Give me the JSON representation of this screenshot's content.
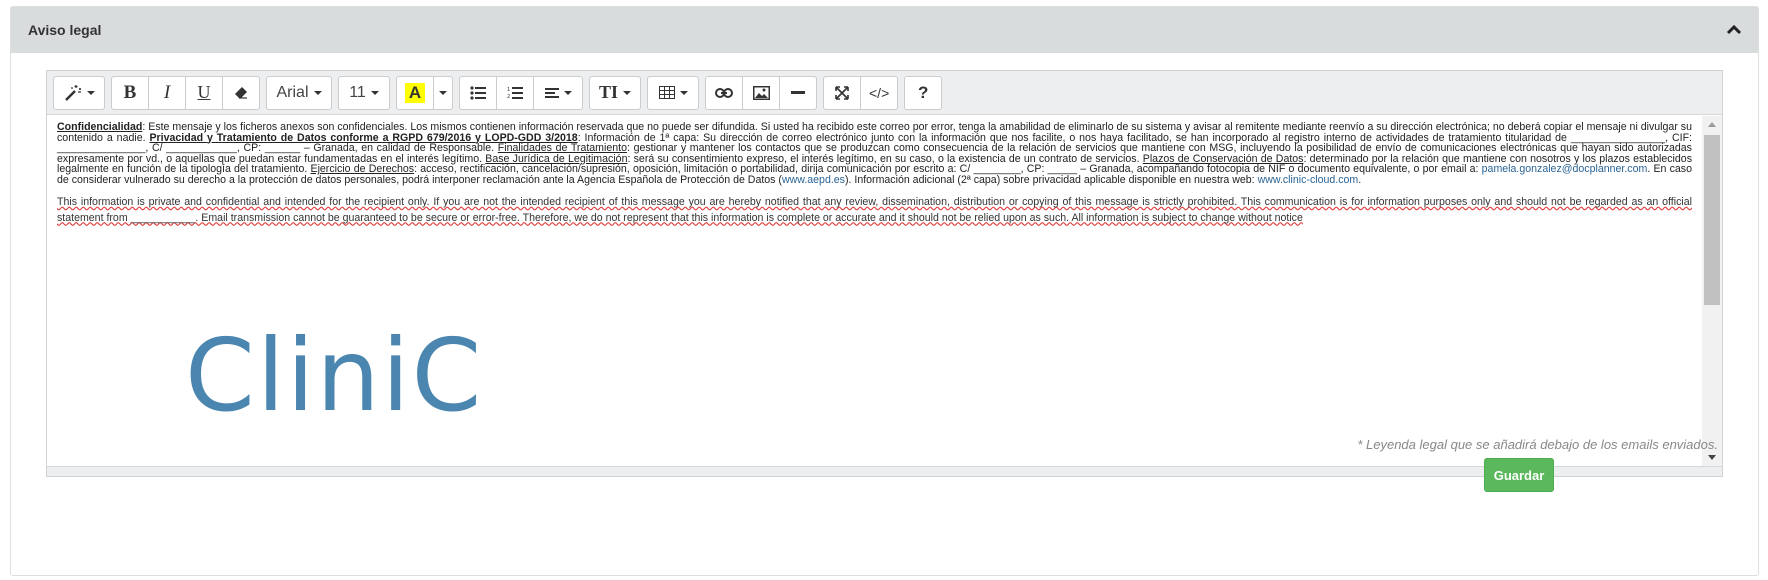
{
  "panel": {
    "title": "Aviso legal",
    "collapse_icon": "chevron-up-icon"
  },
  "toolbar": {
    "style_icon": "magic-wand-icon",
    "bold_label": "B",
    "italic_label": "I",
    "underline_label": "U",
    "eraser_icon": "eraser-icon",
    "font_name": "Arial",
    "font_size": "11",
    "color_label": "A",
    "color_highlight": "#ffff00",
    "ul_icon": "unordered-list-icon",
    "ol_icon": "ordered-list-icon",
    "align_icon": "align-left-icon",
    "line_height_label": "TI",
    "table_icon": "table-icon",
    "link_icon": "link-icon",
    "picture_icon": "picture-icon",
    "hr_icon": "horizontal-rule-icon",
    "fullscreen_icon": "fullscreen-icon",
    "code_label": "</>",
    "help_label": "?"
  },
  "content": {
    "conf_label": "Confidencialidad",
    "conf_text": ": Este mensaje y los ficheros anexos son confidenciales. Los mismos contienen información reservada que no puede ser difundida. Si usted ha recibido este correo por error, tenga la amabilidad de eliminarlo de su sistema y avisar al remitente mediante reenvío a su dirección electrónica; no deberá copiar el mensaje ni divulgar su contenido a nadie. ",
    "priv_label": "Privacidad y Tratamiento de Datos conforme a RGPD 679/2016 y LOPD-GDD 3/2018",
    "priv_text": ": Información de 1ª capa: Su dirección de correo electrónico junto con la información que nos facilite, o nos haya facilitado, se han incorporado al registro interno de actividades de tratamiento titularidad de ________________, CIF: _______________, C/ ____________, CP: ______ – Granada, en calidad de Responsable. ",
    "fin_label": "Finalidades de Tratamiento",
    "fin_text": ": gestionar y mantener los contactos que se produzcan como consecuencia de la relación de servicios que mantiene con MSG, incluyendo la posibilidad de envío de comunicaciones electrónicas que hayan sido autorizadas expresamente por vd., o aquellas que puedan estar fundamentadas en el interés legítimo. ",
    "base_label": "Base Jurídica de Legitimación",
    "base_text": ": será su consentimiento expreso, el interés legítimo, en su caso, o la existencia de un contrato de servicios. ",
    "plazos_label": "Plazos de Conservación de Datos",
    "plazos_text": ": determinado por la relación que mantiene con nosotros y los plazos establecidos legalmente en función de la tipología del tratamiento. ",
    "ejer_label": "Ejercicio de Derechos",
    "ejer_text": ": acceso, rectificación, cancelación/supresión, oposición, limitación o portabilidad, dirija comunicación por escrito a: C/ ________, CP: _____ – Granada, acompañando fotocopia de NIF o documento equivalente, o por email a: ",
    "email": "pamela.gonzalez@docplanner.com",
    "after_email": ".  En caso de considerar vulnerado su derecho a la protección de datos personales, podrá interponer reclamación ante la  Agencia Española de Protección de Datos (",
    "aepd_link": "www.aepd.es",
    "after_aepd": "). Información adicional (2ª capa) sobre privacidad aplicable disponible en nuestra web: ",
    "web_link": "www.clinic-cloud.com",
    "end_dot": ".",
    "english_text": "This information is private and confidential and intended for the recipient only. If you are not the intended recipient of this message you are hereby notified that any review, dissemination, distribution or copying of this message is strictly prohibited. This communication is for information purposes only and should not be regarded as an official statement from ___________. Email transmission cannot be guaranteed to be secure or error-free. Therefore, we do not represent that this information is complete or accurate and it should not be relied upon as such. All information is subject to change without notice",
    "logo_text": "CliniC"
  },
  "hint": "* Leyenda legal que se añadirá debajo de los emails enviados.",
  "save_label": "Guardar",
  "colors": {
    "header_bg": "#d8dcdd",
    "save_green": "#5cb85c",
    "link_blue": "#2a6496",
    "logo_blue": "#4a86b0"
  }
}
